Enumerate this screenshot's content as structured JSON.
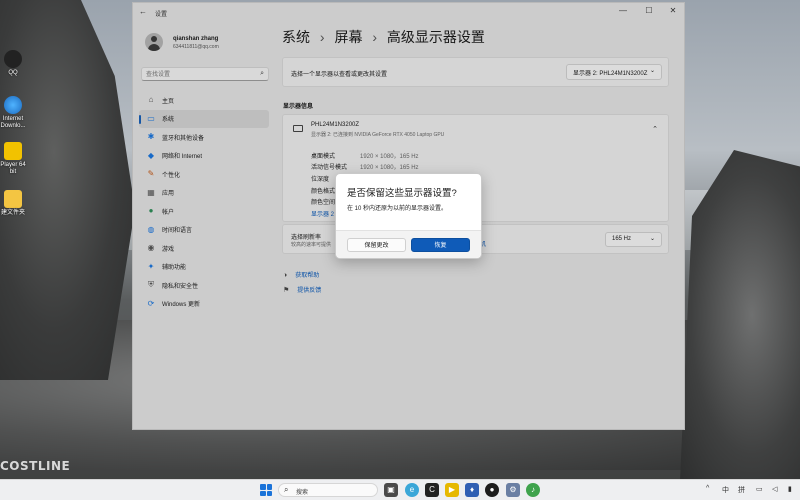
{
  "desktop": {
    "watermark": "COSTLINE",
    "icons": [
      {
        "label": "QQ"
      },
      {
        "label": "Internet Downlo..."
      },
      {
        "label": "Player 64 bit"
      },
      {
        "label": "建文件夹"
      }
    ]
  },
  "window": {
    "title": "设置",
    "controls": {
      "minimize": "—",
      "maximize": "☐",
      "close": "✕"
    }
  },
  "user": {
    "name": "qianshan zhang",
    "email": "634411811@qq.com"
  },
  "search": {
    "placeholder": "查找设置"
  },
  "nav": {
    "items": [
      {
        "label": "主页",
        "icon": "home-icon"
      },
      {
        "label": "系统",
        "icon": "monitor-icon",
        "active": true
      },
      {
        "label": "蓝牙和其他设备",
        "icon": "bluetooth-icon"
      },
      {
        "label": "网络和 Internet",
        "icon": "wifi-icon"
      },
      {
        "label": "个性化",
        "icon": "brush-icon"
      },
      {
        "label": "应用",
        "icon": "apps-icon"
      },
      {
        "label": "帐户",
        "icon": "person-icon"
      },
      {
        "label": "时间和语言",
        "icon": "globe-icon"
      },
      {
        "label": "游戏",
        "icon": "gamepad-icon"
      },
      {
        "label": "辅助功能",
        "icon": "accessibility-icon"
      },
      {
        "label": "隐私和安全性",
        "icon": "shield-icon"
      },
      {
        "label": "Windows 更新",
        "icon": "update-icon"
      }
    ]
  },
  "breadcrumb": {
    "items": [
      "系统",
      "屏幕",
      "高级显示器设置"
    ],
    "separator": "›"
  },
  "display_select": {
    "label": "选择一个显示器以查看或更改其设置",
    "value": "显示器 2: PHL24M1N3200Z"
  },
  "display_info": {
    "section_title": "显示器信息",
    "monitor_name": "PHL24M1N3200Z",
    "monitor_sub": "显示器 2: 已连接到 NVIDIA GeForce RTX 4050 Laptop GPU",
    "rows": [
      {
        "label": "桌面模式",
        "value": "1920 × 1080，165 Hz"
      },
      {
        "label": "活动信号模式",
        "value": "1920 × 1080，165 Hz"
      },
      {
        "label": "位深度",
        "value": ""
      },
      {
        "label": "颜色格式",
        "value": ""
      },
      {
        "label": "颜色空间",
        "value": ""
      }
    ],
    "adapter_link": "显示器 2"
  },
  "refresh": {
    "label": "选择刷新率",
    "sub": "较高的速率可提供",
    "sub_link": "机",
    "value": "165 Hz"
  },
  "help": {
    "get_help": "获取帮助",
    "feedback": "提供反馈"
  },
  "dialog": {
    "title": "是否保留这些显示器设置?",
    "message": "在 10 秒内还原为以前的显示器设置。",
    "keep_label": "保留更改",
    "revert_label": "恢复"
  },
  "taskbar": {
    "search_label": "搜索",
    "tray": {
      "chevron": "^",
      "ime": "中",
      "grid": "拼"
    }
  },
  "colors": {
    "accent": "#0f5bb8",
    "link": "#0a58b5",
    "window_bg": "#dedede"
  }
}
